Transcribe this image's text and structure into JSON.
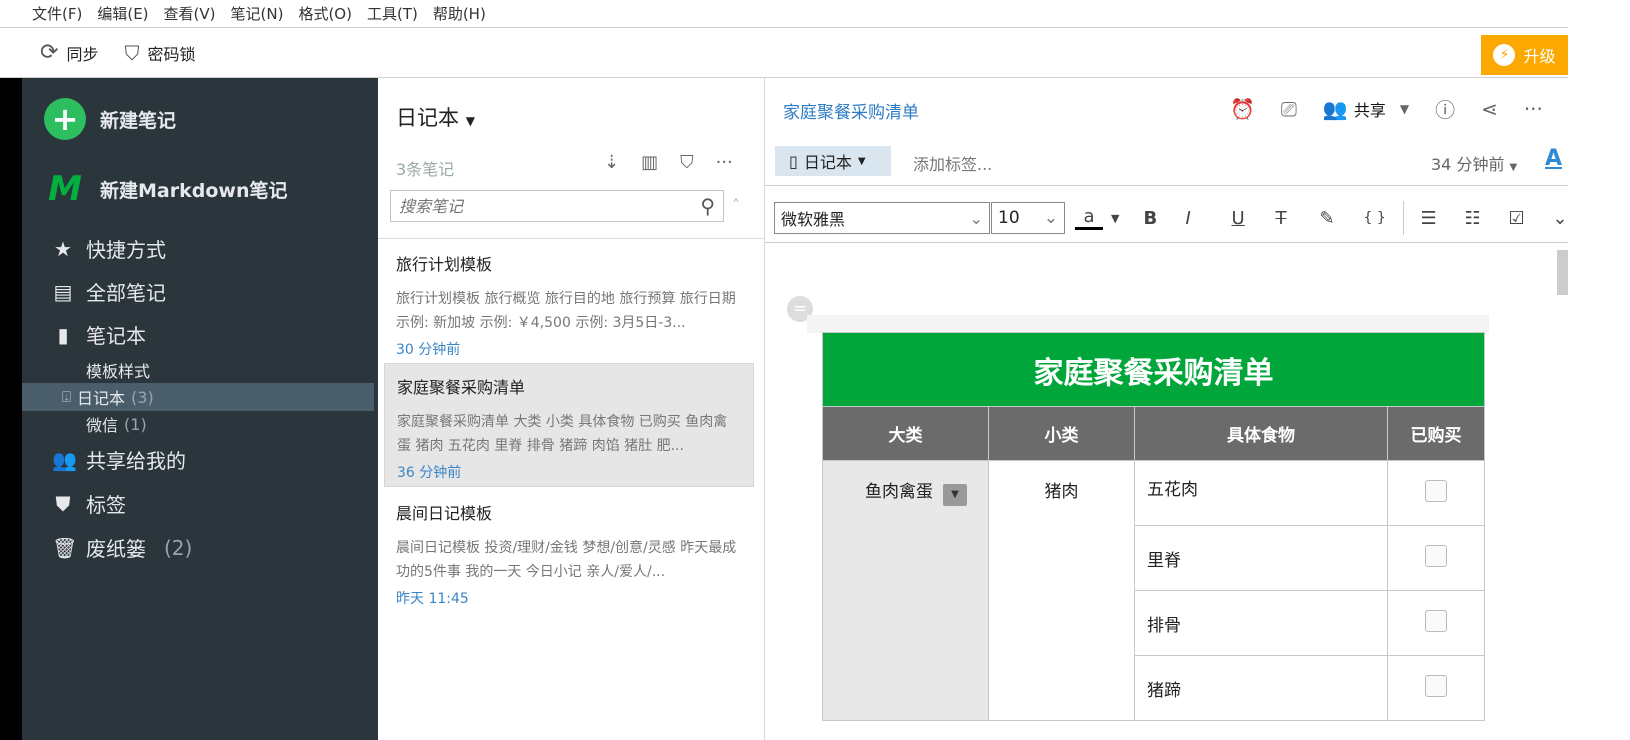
{
  "menu": [
    "文件(F)",
    "编辑(E)",
    "查看(V)",
    "笔记(N)",
    "格式(O)",
    "工具(T)",
    "帮助(H)"
  ],
  "toolbar": {
    "sync": "同步",
    "lock": "密码锁",
    "upgrade": "升级"
  },
  "sidebar": {
    "new_note": "新建笔记",
    "new_md": "新建Markdown笔记",
    "shortcuts": "快捷方式",
    "all_notes": "全部笔记",
    "notebooks": "笔记本",
    "subs": [
      {
        "label": "模板样式",
        "count": ""
      },
      {
        "label": "日记本",
        "count": "(3)"
      },
      {
        "label": "微信",
        "count": "(1)"
      }
    ],
    "shared": "共享给我的",
    "tags": "标签",
    "trash": "废纸篓",
    "trash_count": "(2)"
  },
  "list": {
    "title": "日记本",
    "count": "3条笔记",
    "search_placeholder": "搜索笔记",
    "notes": [
      {
        "title": "旅行计划模板",
        "preview": "旅行计划模板 旅行概览 旅行目的地 旅行预算 旅行日期 示例: 新加坡 示例: ￥4,500 示例: 3月5日-3...",
        "date": "30 分钟前"
      },
      {
        "title": "家庭聚餐采购清单",
        "preview": "家庭聚餐采购清单 大类 小类 具体食物 已购买 鱼肉禽蛋 猪肉 五花肉 里脊 排骨 猪蹄 肉馅 猪肚 肥...",
        "date": "36 分钟前"
      },
      {
        "title": "晨间日记模板",
        "preview": "晨间日记模板 投资/理财/金钱 梦想/创意/灵感 昨天最成功的5件事 我的一天 今日小记 亲人/爱人/...",
        "date": "昨天 11:45"
      }
    ]
  },
  "editor": {
    "title": "家庭聚餐采购清单",
    "share": "共享",
    "notebook": "日记本",
    "add_tag": "添加标签...",
    "time": "34 分钟前",
    "font": "微软雅黑",
    "size": "10",
    "table": {
      "title": "家庭聚餐采购清单",
      "headers": [
        "大类",
        "小类",
        "具体食物",
        "已购买"
      ],
      "category": "鱼肉禽蛋",
      "subcategory": "猪肉",
      "items": [
        "五花肉",
        "里脊",
        "排骨",
        "猪蹄"
      ]
    }
  },
  "colors": {
    "sidebar": "#2b353c",
    "accent_green": "#00a63a",
    "upgrade": "#fba900",
    "link": "#3a86c8"
  }
}
